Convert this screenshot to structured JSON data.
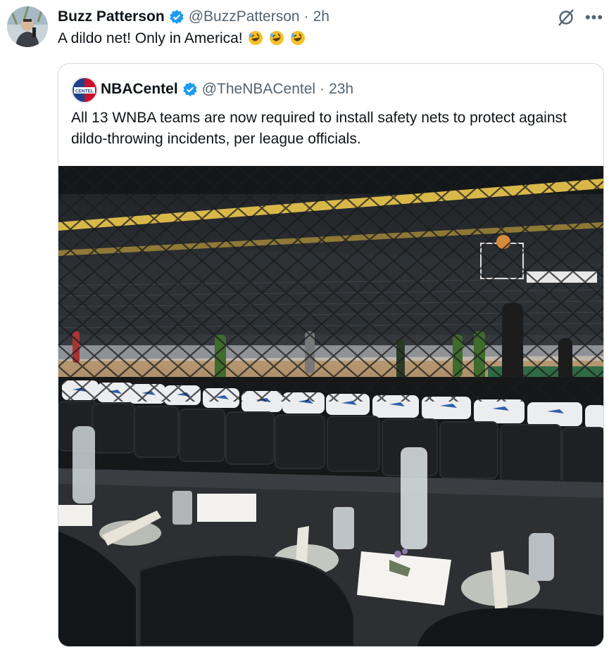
{
  "post": {
    "author_name": "Buzz Patterson",
    "handle": "@BuzzPatterson",
    "separator": "·",
    "time": "2h",
    "text": "A dildo net! Only in America!",
    "emoji": [
      "rolling-on-floor-laughing",
      "rolling-on-floor-laughing",
      "rolling-on-floor-laughing"
    ],
    "verified": true
  },
  "quoted": {
    "author_name": "NBACentel",
    "avatar_label": "CENTEL",
    "handle": "@TheNBACentel",
    "separator": "·",
    "time": "23h",
    "text": "All 13 WNBA teams are now required to install safety nets to protect against dildo-throwing incidents, per league officials.",
    "verified": true
  },
  "colors": {
    "verified": "#1d9bf0",
    "secondary_text": "#536471",
    "border": "#cfd9de"
  },
  "icons": {
    "verified": "verified-badge-icon",
    "grok": "grok-icon",
    "more": "more-options-icon"
  }
}
